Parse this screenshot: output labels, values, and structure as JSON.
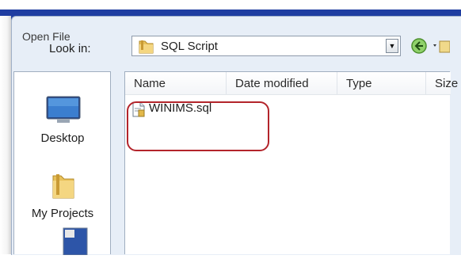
{
  "dialog": {
    "title": "Open File"
  },
  "toolbar": {
    "look_in_label": "Look in:",
    "look_in_value": "SQL Script"
  },
  "places": [
    {
      "label": "Desktop",
      "icon": "desktop-icon"
    },
    {
      "label": "My Projects",
      "icon": "folder-icon"
    }
  ],
  "columns": [
    "Name",
    "Date modified",
    "Type",
    "Size"
  ],
  "files": [
    {
      "name": "WINIMS.sql",
      "icon": "sql-file-icon"
    }
  ],
  "colors": {
    "highlight": "#b3242b",
    "title_bar": "#1f3da1"
  }
}
